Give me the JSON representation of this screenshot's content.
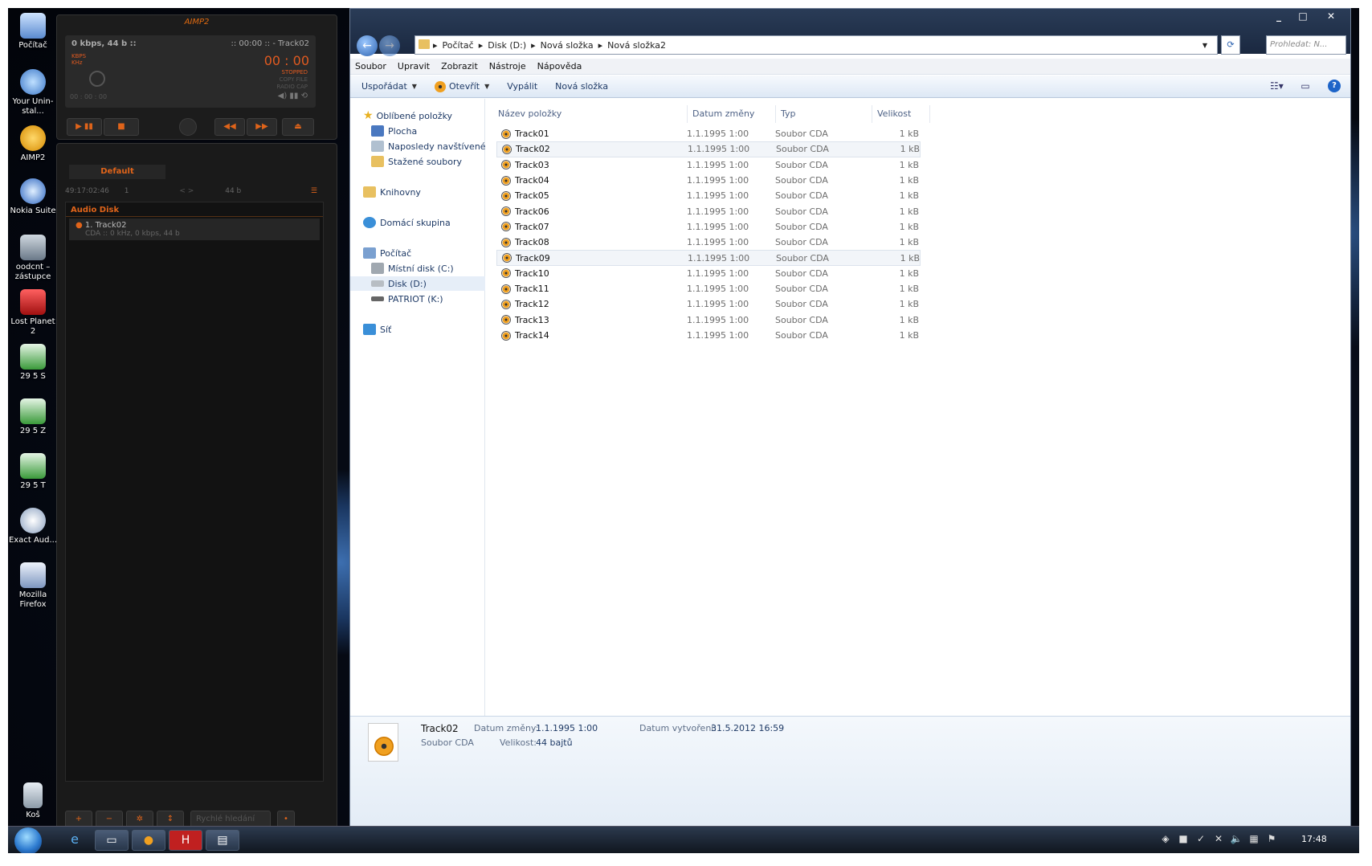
{
  "desktop": {
    "icons": [
      {
        "label": "Počítač"
      },
      {
        "label": "Your Unin-stal..."
      },
      {
        "label": "AIMP2"
      },
      {
        "label": "Nokia Suite"
      },
      {
        "label": "oodcnt – zástupce"
      },
      {
        "label": "Lost Planet 2"
      },
      {
        "label": "29 5 S"
      },
      {
        "label": "29 5 Z"
      },
      {
        "label": "29 5 T"
      },
      {
        "label": "Exact Aud..."
      },
      {
        "label": "Mozilla Firefox"
      },
      {
        "label": "Koš"
      }
    ]
  },
  "aimp": {
    "title": "AIMP2",
    "lcd_info": "0 kbps, 44 b ::",
    "lcd_track": ":: 00:00 :: - Track02",
    "time": "00 : 00",
    "kbps": "KBPS",
    "khz": "KHz",
    "status": "STOPPED",
    "copy": "COPY FILE",
    "radio": "RADIO CAP",
    "small_time": "00 : 00 : 00",
    "playlist_tab": "Default",
    "playlist_time": "49:17:02:46",
    "playlist_count": "1",
    "playlist_size": "44 b",
    "group": "Audio Disk",
    "item_title": "1. Track02",
    "item_sub": "CDA :: 0 kHz, 0 kbps, 44 b",
    "quick_search": "Rychlé hledání"
  },
  "explorer": {
    "breadcrumb": [
      "Počítač",
      "Disk (D:)",
      "Nová složka",
      "Nová složka2"
    ],
    "search_placeholder": "Prohledat: N...",
    "menu": [
      "Soubor",
      "Upravit",
      "Zobrazit",
      "Nástroje",
      "Nápověda"
    ],
    "commands": {
      "organize": "Uspořádat",
      "open": "Otevřít",
      "burn": "Vypálit",
      "new_folder": "Nová složka"
    },
    "nav": {
      "favorites": "Oblíbené položky",
      "desktop": "Plocha",
      "recent": "Naposledy navštívené",
      "downloads": "Stažené soubory",
      "libraries": "Knihovny",
      "homegroup": "Domácí skupina",
      "computer": "Počítač",
      "local_disk": "Místní disk (C:)",
      "disk_d": "Disk (D:)",
      "patriot": "PATRIOT (K:)",
      "network": "Síť"
    },
    "columns": {
      "name": "Název položky",
      "date": "Datum změny",
      "type": "Typ",
      "size": "Velikost"
    },
    "files": [
      {
        "name": "Track01",
        "date": "1.1.1995 1:00",
        "type": "Soubor CDA",
        "size": "1 kB"
      },
      {
        "name": "Track02",
        "date": "1.1.1995 1:00",
        "type": "Soubor CDA",
        "size": "1 kB"
      },
      {
        "name": "Track03",
        "date": "1.1.1995 1:00",
        "type": "Soubor CDA",
        "size": "1 kB"
      },
      {
        "name": "Track04",
        "date": "1.1.1995 1:00",
        "type": "Soubor CDA",
        "size": "1 kB"
      },
      {
        "name": "Track05",
        "date": "1.1.1995 1:00",
        "type": "Soubor CDA",
        "size": "1 kB"
      },
      {
        "name": "Track06",
        "date": "1.1.1995 1:00",
        "type": "Soubor CDA",
        "size": "1 kB"
      },
      {
        "name": "Track07",
        "date": "1.1.1995 1:00",
        "type": "Soubor CDA",
        "size": "1 kB"
      },
      {
        "name": "Track08",
        "date": "1.1.1995 1:00",
        "type": "Soubor CDA",
        "size": "1 kB"
      },
      {
        "name": "Track09",
        "date": "1.1.1995 1:00",
        "type": "Soubor CDA",
        "size": "1 kB"
      },
      {
        "name": "Track10",
        "date": "1.1.1995 1:00",
        "type": "Soubor CDA",
        "size": "1 kB"
      },
      {
        "name": "Track11",
        "date": "1.1.1995 1:00",
        "type": "Soubor CDA",
        "size": "1 kB"
      },
      {
        "name": "Track12",
        "date": "1.1.1995 1:00",
        "type": "Soubor CDA",
        "size": "1 kB"
      },
      {
        "name": "Track13",
        "date": "1.1.1995 1:00",
        "type": "Soubor CDA",
        "size": "1 kB"
      },
      {
        "name": "Track14",
        "date": "1.1.1995 1:00",
        "type": "Soubor CDA",
        "size": "1 kB"
      }
    ],
    "details": {
      "name": "Track02",
      "type": "Soubor CDA",
      "modified_label": "Datum změny:",
      "modified_value": "1.1.1995 1:00",
      "size_label": "Velikost:",
      "size_value": "44 bajtů",
      "created_label": "Datum vytvoření:",
      "created_value": "31.5.2012 16:59"
    }
  },
  "taskbar": {
    "clock": "17:48"
  }
}
